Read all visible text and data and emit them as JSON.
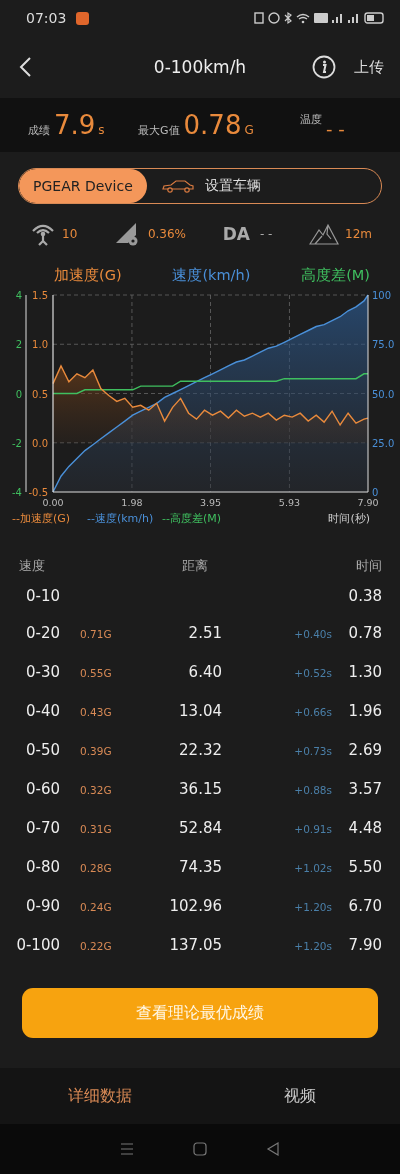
{
  "status_bar": {
    "time": "07:03"
  },
  "nav": {
    "title": "0-100km/h",
    "action": "上传"
  },
  "stats": [
    {
      "label": "成绩",
      "value": "7.9",
      "unit": "s"
    },
    {
      "label": "最大G值",
      "value": "0.78",
      "unit": "G"
    },
    {
      "label": "温度",
      "value": "- -"
    }
  ],
  "segments": [
    {
      "label": "PGEAR Device",
      "selected": true
    },
    {
      "label": "设置车辆",
      "selected": false
    }
  ],
  "readings": [
    {
      "kind": "satellites",
      "value": "10"
    },
    {
      "kind": "slope",
      "value": "0.36%"
    },
    {
      "kind": "da",
      "label": "DA",
      "value": "- -"
    },
    {
      "kind": "altitude",
      "value": "12m"
    }
  ],
  "chart": {
    "titles": [
      {
        "text": "加速度(G)",
        "color": "#e98a3c"
      },
      {
        "text": "速度(km/h)",
        "color": "#4a90d9"
      },
      {
        "text": "高度差(M)",
        "color": "#3fbf5f"
      }
    ],
    "chart_data": {
      "type": "area",
      "grid": true,
      "xlabel": "时间(秒)",
      "x": [
        0,
        0.2,
        0.4,
        0.6,
        0.8,
        1.0,
        1.2,
        1.4,
        1.6,
        1.8,
        2.0,
        2.2,
        2.4,
        2.6,
        2.8,
        3.0,
        3.2,
        3.4,
        3.6,
        3.8,
        4.0,
        4.2,
        4.4,
        4.6,
        4.8,
        5.0,
        5.2,
        5.4,
        5.6,
        5.8,
        6.0,
        6.2,
        6.4,
        6.6,
        6.8,
        7.0,
        7.2,
        7.4,
        7.6,
        7.8,
        7.9
      ],
      "xlim": [
        0,
        7.9
      ],
      "xticks": [
        {
          "value": 0,
          "label": "0.00"
        },
        {
          "value": 1.98,
          "label": "1.98"
        },
        {
          "value": 3.95,
          "label": "3.95"
        },
        {
          "value": 5.93,
          "label": "5.93"
        },
        {
          "value": 7.9,
          "label": "7.90"
        }
      ],
      "ylim": [
        -0.5,
        1.5
      ],
      "yticks": [
        {
          "value": -0.5,
          "label": "-0.5"
        },
        {
          "value": 0,
          "label": "0.0"
        },
        {
          "value": 0.5,
          "label": "0.5"
        },
        {
          "value": 1,
          "label": "1.0"
        },
        {
          "value": 1.5,
          "label": "1.5"
        }
      ],
      "y2lim": [
        0,
        100
      ],
      "y2ticks": [
        {
          "value": 0,
          "label": "0"
        },
        {
          "value": 25,
          "label": "25.0"
        },
        {
          "value": 50,
          "label": "50.0"
        },
        {
          "value": 75,
          "label": "75.0"
        },
        {
          "value": 100,
          "label": "100"
        }
      ],
      "y3lim": [
        -4,
        4
      ],
      "y3ticks": [
        -4,
        -2,
        0,
        2,
        4
      ],
      "series": [
        {
          "name": "--加速度(G)",
          "color": "#e98a3c",
          "values": [
            0.6,
            0.78,
            0.62,
            0.7,
            0.66,
            0.74,
            0.55,
            0.48,
            0.42,
            0.45,
            0.36,
            0.38,
            0.33,
            0.4,
            0.22,
            0.36,
            0.45,
            0.3,
            0.24,
            0.33,
            0.28,
            0.32,
            0.25,
            0.33,
            0.27,
            0.3,
            0.26,
            0.3,
            0.23,
            0.28,
            0.26,
            0.3,
            0.22,
            0.28,
            0.21,
            0.32,
            0.18,
            0.3,
            0.2,
            0.24,
            0.25
          ]
        },
        {
          "name": "--速度(km/h)",
          "color": "#4a90d9",
          "axis": "y2",
          "values": [
            0,
            8,
            13,
            17,
            21,
            24,
            27,
            30,
            33,
            36,
            39,
            41,
            43,
            45,
            48,
            50,
            52,
            54,
            56,
            58,
            60,
            62,
            64,
            66,
            67,
            69,
            71,
            73,
            74,
            76,
            78,
            80,
            82,
            84,
            85,
            87,
            89,
            92,
            94,
            97,
            100
          ]
        },
        {
          "name": "--高度差(M)",
          "color": "#3fbf5f",
          "axis": "y3",
          "type": "line",
          "values": [
            0,
            0,
            0,
            0,
            0.15,
            0.15,
            0.15,
            0.15,
            0.15,
            0.15,
            0.15,
            0.3,
            0.3,
            0.3,
            0.3,
            0.3,
            0.5,
            0.5,
            0.5,
            0.5,
            0.5,
            0.5,
            0.5,
            0.5,
            0.5,
            0.5,
            0.5,
            0.5,
            0.5,
            0.6,
            0.6,
            0.6,
            0.6,
            0.6,
            0.6,
            0.6,
            0.6,
            0.6,
            0.6,
            0.8,
            0.8
          ]
        }
      ]
    }
  },
  "table": {
    "columns": [
      {
        "label": "速度"
      },
      {
        "label": "距离"
      },
      {
        "label": "时间"
      }
    ],
    "rows": [
      {
        "speed": "0-10",
        "time": "0.38"
      },
      {
        "speed": "0-20",
        "g": "0.71G",
        "distance": "2.51",
        "delta": "+0.40s",
        "time": "0.78"
      },
      {
        "speed": "0-30",
        "g": "0.55G",
        "distance": "6.40",
        "delta": "+0.52s",
        "time": "1.30"
      },
      {
        "speed": "0-40",
        "g": "0.43G",
        "distance": "13.04",
        "delta": "+0.66s",
        "time": "1.96"
      },
      {
        "speed": "0-50",
        "g": "0.39G",
        "distance": "22.32",
        "delta": "+0.73s",
        "time": "2.69"
      },
      {
        "speed": "0-60",
        "g": "0.32G",
        "distance": "36.15",
        "delta": "+0.88s",
        "time": "3.57"
      },
      {
        "speed": "0-70",
        "g": "0.31G",
        "distance": "52.84",
        "delta": "+0.91s",
        "time": "4.48"
      },
      {
        "speed": "0-80",
        "g": "0.28G",
        "distance": "74.35",
        "delta": "+1.02s",
        "time": "5.50"
      },
      {
        "speed": "0-90",
        "g": "0.24G",
        "distance": "102.96",
        "delta": "+1.20s",
        "time": "6.70"
      },
      {
        "speed": "0-100",
        "g": "0.22G",
        "distance": "137.05",
        "delta": "+1.20s",
        "time": "7.90"
      }
    ]
  },
  "primary_button": "查看理论最优成绩",
  "tabs": [
    {
      "label": "详细数据",
      "selected": true
    },
    {
      "label": "视频",
      "selected": false
    }
  ]
}
